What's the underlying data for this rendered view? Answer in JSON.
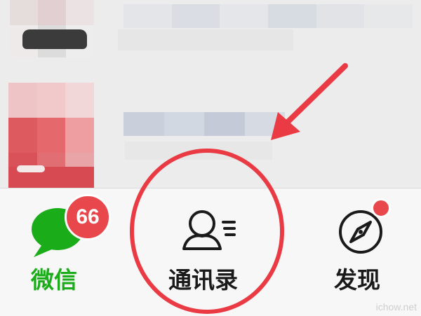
{
  "tabs": [
    {
      "label": "微信",
      "badge": "66",
      "icon": "chat-bubble-icon",
      "active": true
    },
    {
      "label": "通讯录",
      "icon": "contacts-icon",
      "active": false
    },
    {
      "label": "发现",
      "icon": "compass-icon",
      "active": false,
      "dot": true
    }
  ],
  "colors": {
    "active_green": "#1aad19",
    "badge_red": "#e8484b",
    "annotation_red": "#ea3b45",
    "label_dark": "#1a1a1a"
  },
  "watermark": "ichow.net"
}
